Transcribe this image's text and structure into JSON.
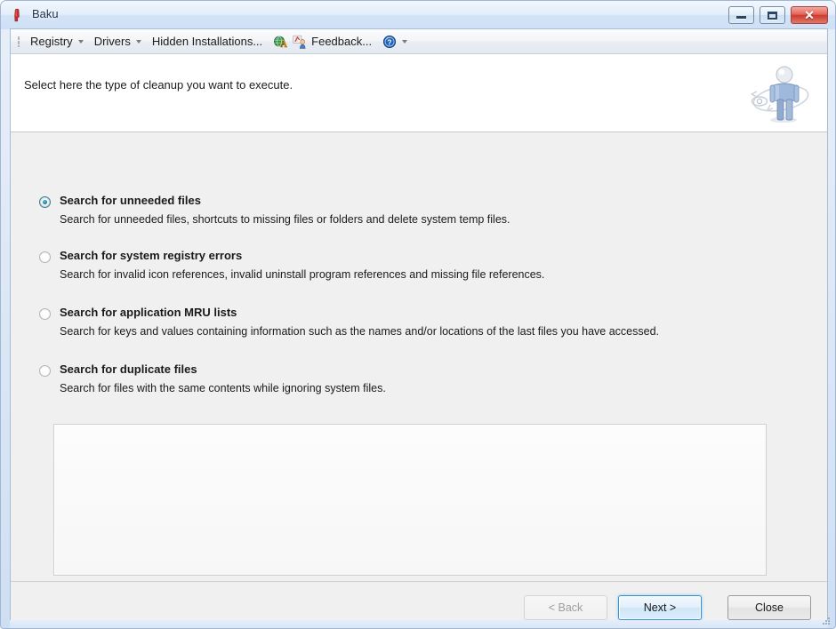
{
  "window": {
    "title": "Baku",
    "app_icon": "baku-app-icon",
    "controls": {
      "minimize": "minimize-button",
      "maximize": "maximize-button",
      "close": "close-button",
      "close_glyph": "✕"
    }
  },
  "toolbar": {
    "grip": "toolbar-grip",
    "items": [
      {
        "label": "Registry",
        "has_caret": true,
        "icon": null
      },
      {
        "label": "Drivers",
        "has_caret": true,
        "icon": null
      },
      {
        "label": "Hidden Installations...",
        "has_caret": false,
        "icon": null
      },
      {
        "label": "",
        "has_caret": false,
        "icon": "language-globe-icon"
      },
      {
        "label": "Feedback...",
        "has_caret": false,
        "icon": "feedback-person-icon"
      },
      {
        "label": "",
        "has_caret": true,
        "icon": "help-question-icon"
      }
    ]
  },
  "header": {
    "instruction": "Select here the type of cleanup you want to execute.",
    "artwork": "user-refresh-illustration"
  },
  "options": {
    "selected_index": 0,
    "items": [
      {
        "title": "Search for unneeded files",
        "description": "Search for unneeded files, shortcuts to missing files or folders and delete system temp files.",
        "selected": true
      },
      {
        "title": "Search for system registry errors",
        "description": "Search for invalid icon references, invalid uninstall program references and missing file references.",
        "selected": false
      },
      {
        "title": "Search for application MRU lists",
        "description": "Search for keys and values containing information such as the names and/or locations of the last files you have accessed.",
        "selected": false
      },
      {
        "title": "Search for duplicate files",
        "description": "Search for files with the same contents while ignoring system files.",
        "selected": false
      }
    ]
  },
  "results_panel": {
    "name": "results-list-panel",
    "content": ""
  },
  "footer": {
    "back_label": "< Back",
    "back_enabled": false,
    "next_label": "Next >",
    "next_is_default": true,
    "close_label": "Close"
  },
  "colors": {
    "accent_blue": "#2e95d3",
    "frame_blue": "#cfe0f6",
    "close_red": "#cf3a2e",
    "radio_selected": "#1f7f9c",
    "client_bg": "#f0f0f0",
    "header_bg": "#ffffff"
  }
}
